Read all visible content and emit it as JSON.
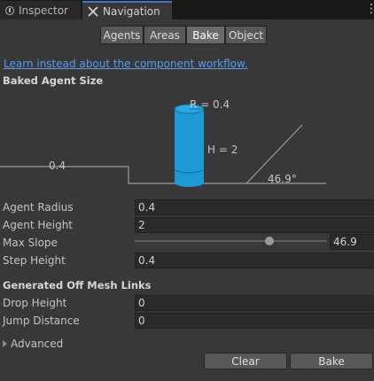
{
  "tabs": [
    {
      "label": "Inspector",
      "icon": "info-icon"
    },
    {
      "label": "Navigation",
      "icon": "navigation-icon"
    }
  ],
  "segments": [
    "Agents",
    "Areas",
    "Bake",
    "Object"
  ],
  "selected_segment": "Bake",
  "link_text": "Learn instead about the component workflow.",
  "baked_agent_size": {
    "header": "Baked Agent Size",
    "radius_label": "R = 0.4",
    "height_label": "H = 2",
    "step_label": "0.4",
    "slope_label": "46.9°"
  },
  "fields": {
    "agent_radius": {
      "label": "Agent Radius",
      "value": "0.4"
    },
    "agent_height": {
      "label": "Agent Height",
      "value": "2"
    },
    "max_slope": {
      "label": "Max Slope",
      "value": "46.9",
      "fraction": 0.7
    },
    "step_height": {
      "label": "Step Height",
      "value": "0.4"
    }
  },
  "off_mesh": {
    "header": "Generated Off Mesh Links",
    "drop_height": {
      "label": "Drop Height",
      "value": "0"
    },
    "jump_distance": {
      "label": "Jump Distance",
      "value": "0"
    }
  },
  "advanced_label": "Advanced",
  "buttons": {
    "clear": "Clear",
    "bake": "Bake"
  },
  "colors": {
    "accent": "#3a79bb",
    "agent_cylinder": "#1c9ad6",
    "link": "#5a9bf1"
  }
}
